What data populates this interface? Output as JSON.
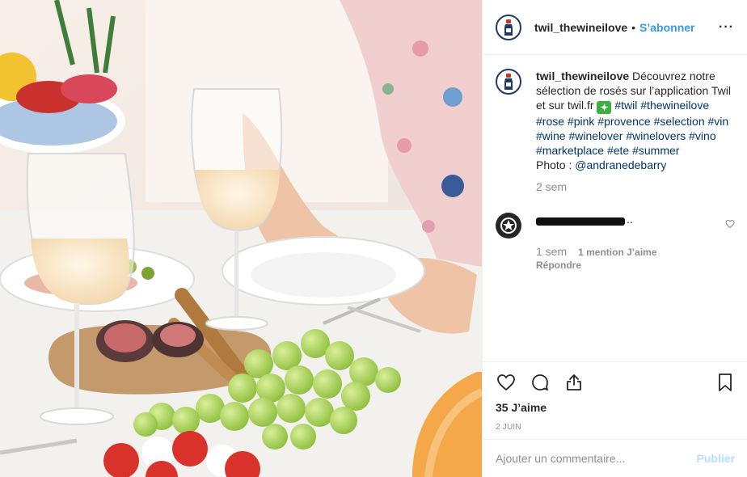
{
  "post": {
    "username": "twil_thewineilove",
    "follow_label": "S’abonner",
    "separator": "•",
    "more_label": "···",
    "photo_alt": "Table dressée avec verres de vin rosé, raisins, figues et melon"
  },
  "caption": {
    "username": "twil_thewineilove",
    "text_1": "Découvrez notre sélection de rosés sur l’application Twil et sur twil.fr",
    "emoji": "✦",
    "hashtags": [
      "#twil",
      "#thewineilove",
      "#rose",
      "#pink",
      "#provence",
      "#selection",
      "#vin",
      "#wine",
      "#winelover",
      "#winelovers",
      "#vino",
      "#marketplace",
      "#ete",
      "#summer"
    ],
    "photo_prefix": "Photo : ",
    "photo_mention": "@andranedebarry",
    "time": "2 sem"
  },
  "comment": {
    "visible_tail": "..",
    "time": "1 sem",
    "likes": "1 mention J’aime",
    "reply_label": "Répondre"
  },
  "actions": {
    "likes_count": "35 J’aime",
    "date": "2 JUIN"
  },
  "add_comment": {
    "placeholder": "Ajouter un commentaire...",
    "post_label": "Publier"
  },
  "colors": {
    "link_blue": "#3897f0",
    "hashtag_blue": "#003569",
    "muted_gray": "#8e8e8e",
    "disabled_blue": "#b2dffc",
    "brand_navy": "#1f3a63"
  },
  "icons": [
    "heart-icon",
    "comment-icon",
    "share-icon",
    "bookmark-icon",
    "more-icon",
    "wine-bottle-logo-icon",
    "star-avatar-icon"
  ]
}
